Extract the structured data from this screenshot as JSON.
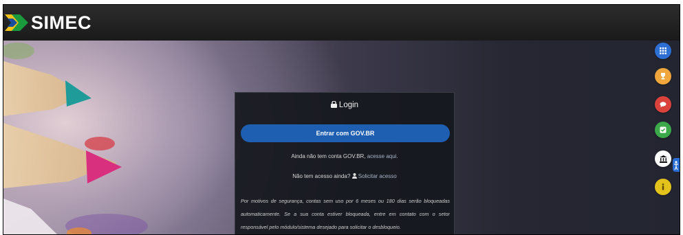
{
  "app": {
    "name": "SIMEC"
  },
  "login": {
    "title": "Login",
    "govbr_button": "Entrar com GOV.BR",
    "no_account_text": "Ainda não tem conta GOV.BR, ",
    "no_account_link": "acesse aqui.",
    "no_access_text": "Não tem acesso ainda? ",
    "request_access_link": "Solicitar acesso",
    "security_notice": "Por motivos de segurança, contas sem uso por 6 meses ou 180 dias serão bloqueadas automaticamente. Se a sua conta estiver bloqueada, entre em contato com o setor responsável pelo módulo/sistema desejado para solicitar o desbloqueio."
  },
  "sidebar": {
    "buttons": [
      {
        "name": "grid-icon",
        "color": "#2d6fd2"
      },
      {
        "name": "trophy-icon",
        "color": "#f0a63c"
      },
      {
        "name": "chat-icon",
        "color": "#d9433c"
      },
      {
        "name": "check-icon",
        "color": "#3ca84a"
      },
      {
        "name": "institution-icon",
        "color": "#ffffff"
      },
      {
        "name": "info-icon",
        "color": "#e3c21c"
      }
    ]
  },
  "colors": {
    "header": "#1f1f1f",
    "govbr_button": "#1f5fb2",
    "login_panel": "#16181e"
  }
}
